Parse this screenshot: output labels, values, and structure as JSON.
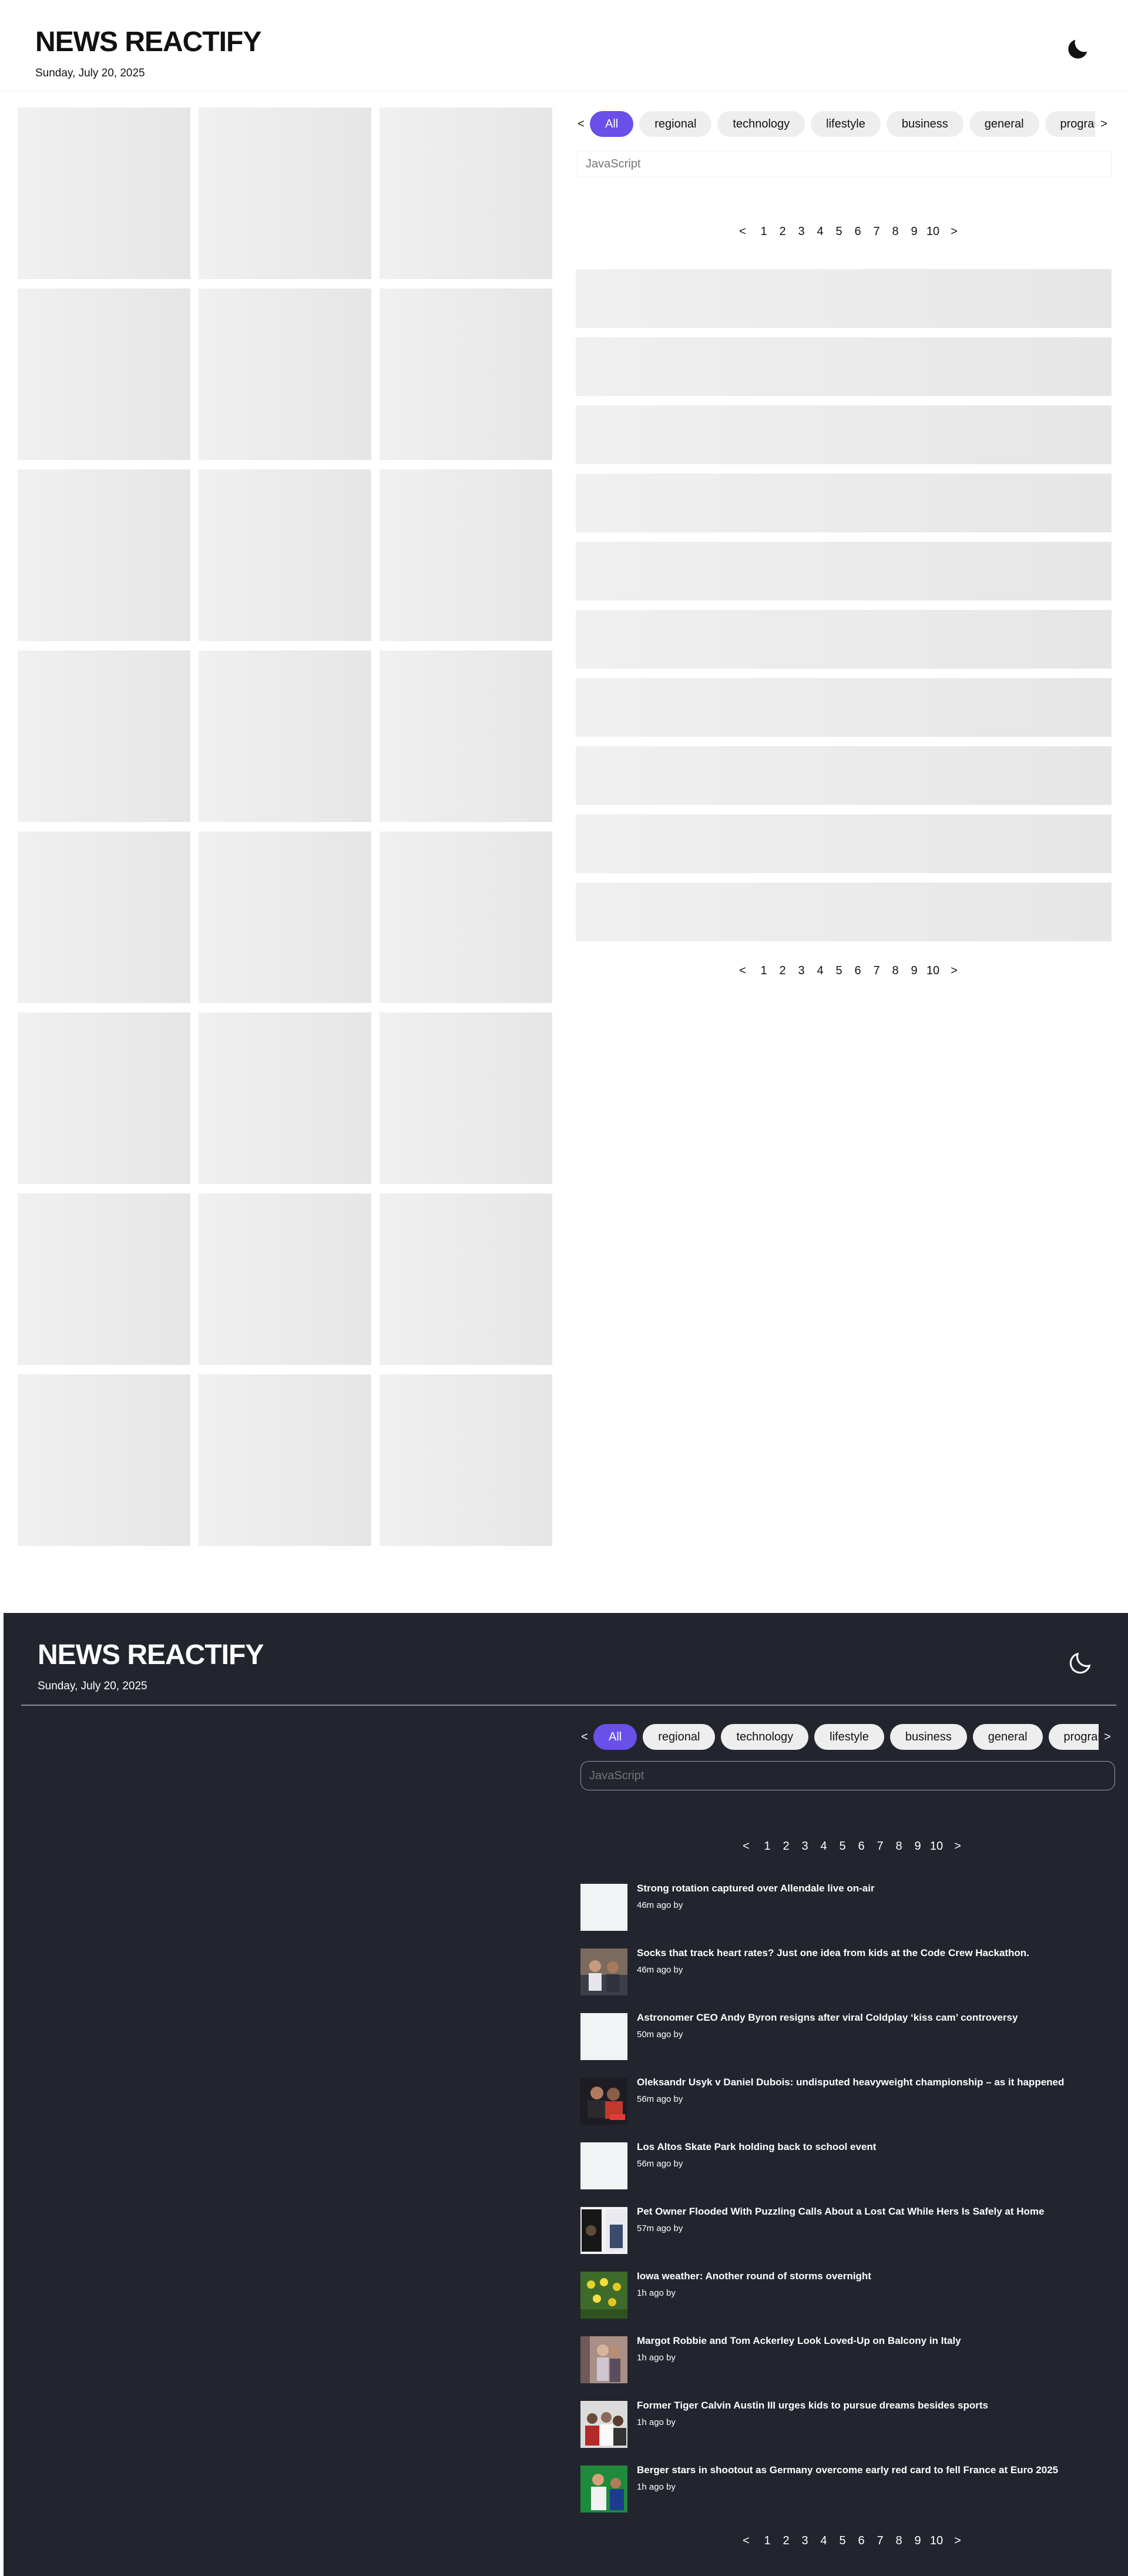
{
  "app": {
    "title": "NEWS REACTIFY",
    "date": "Sunday, July 20, 2025"
  },
  "categories": {
    "prev": "<",
    "next": ">",
    "items": [
      "All",
      "regional",
      "technology",
      "lifestyle",
      "business",
      "general",
      "programming"
    ],
    "active": "All"
  },
  "search": {
    "placeholder": "JavaScript"
  },
  "pagination": {
    "prev": "<",
    "next": ">",
    "pages": [
      "1",
      "2",
      "3",
      "4",
      "5",
      "6",
      "7",
      "8",
      "9",
      "10"
    ]
  },
  "icons": {
    "theme_toggle_light": "moon-filled-icon",
    "theme_toggle_dark": "moon-outline-icon"
  },
  "colors": {
    "accent": "#6a4fe8",
    "dark_bg": "#22252e"
  },
  "news": [
    {
      "title": "Strong rotation captured over Allendale live on-air",
      "meta": "46m ago by",
      "thumb": "placeholder"
    },
    {
      "title": "Socks that track heart rates? Just one idea from kids at the Code Crew Hackathon.",
      "meta": "46m ago by",
      "thumb": "people"
    },
    {
      "title": "Astronomer CEO Andy Byron resigns after viral Coldplay ‘kiss cam’ controversy",
      "meta": "50m ago by",
      "thumb": "placeholder"
    },
    {
      "title": "Oleksandr Usyk v Daniel Dubois: undisputed heavyweight championship – as it happened",
      "meta": "56m ago by",
      "thumb": "boxing"
    },
    {
      "title": "Los Altos Skate Park holding back to school event",
      "meta": "56m ago by",
      "thumb": "placeholder"
    },
    {
      "title": "Pet Owner Flooded With Puzzling Calls About a Lost Cat While Hers Is Safely at Home",
      "meta": "57m ago by",
      "thumb": "cat"
    },
    {
      "title": "Iowa weather: Another round of storms overnight",
      "meta": "1h ago by",
      "thumb": "flowers"
    },
    {
      "title": "Margot Robbie and Tom Ackerley Look Loved-Up on Balcony in Italy",
      "meta": "1h ago by",
      "thumb": "couple"
    },
    {
      "title": "Former Tiger Calvin Austin III urges kids to pursue dreams besides sports",
      "meta": "1h ago by",
      "thumb": "crowd"
    },
    {
      "title": "Berger stars in shootout as Germany overcome early red card to fell France at Euro 2025",
      "meta": "1h ago by",
      "thumb": "football"
    }
  ]
}
